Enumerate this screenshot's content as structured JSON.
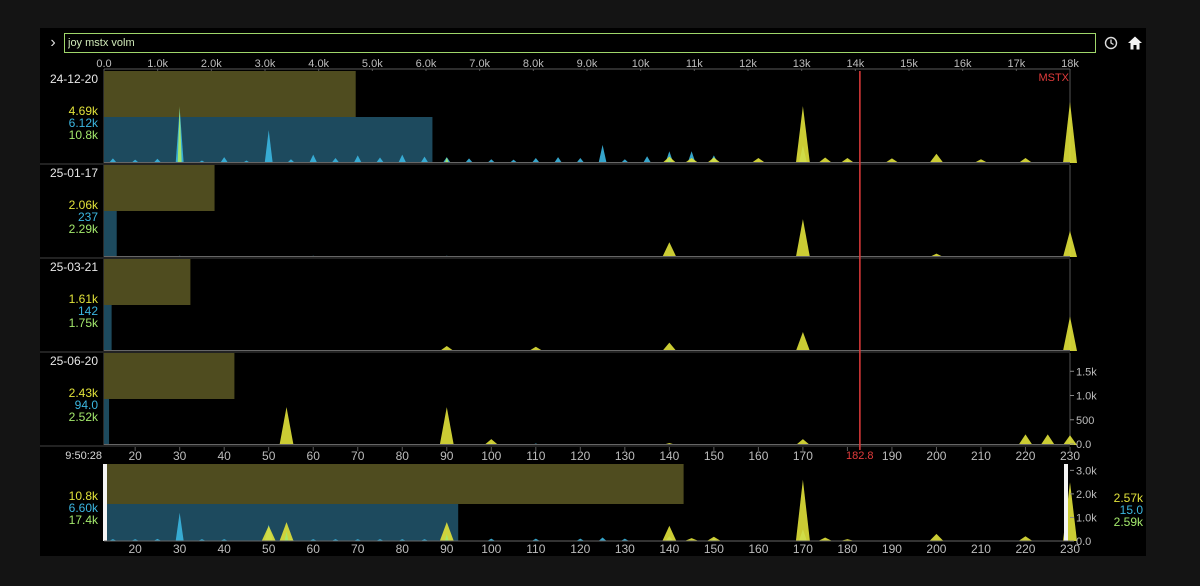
{
  "command": {
    "value": "joy mstx volm"
  },
  "icons": {
    "left": "chevron-right-icon",
    "settings": "clock-gear-icon",
    "home": "home-icon"
  },
  "colors": {
    "yellow": "#e1e23a",
    "blue": "#3bb6e0",
    "green": "#a3e86c",
    "yellow_bar": "#4f4c1f",
    "blue_bar": "#1d4a5e",
    "marker": "#e23b3b",
    "axis_text": "#bdbdbd",
    "bg": "#000000"
  },
  "chart_data": {
    "type": "area",
    "symbol": "MSTX",
    "marker": {
      "price": 182.8,
      "label": "182.8"
    },
    "time_label": "9:50:28",
    "volume_axis": {
      "ticks": [
        0,
        1000,
        2000,
        3000,
        4000,
        5000,
        6000,
        7000,
        8000,
        9000,
        10000,
        11000,
        12000,
        13000,
        14000,
        15000,
        16000,
        17000,
        18000
      ],
      "tick_labels": [
        "0.0",
        "1.0k",
        "2.0k",
        "3.0k",
        "4.0k",
        "5.0k",
        "6.0k",
        "7.0k",
        "8.0k",
        "9.0k",
        "10k",
        "11k",
        "12k",
        "13k",
        "14k",
        "15k",
        "16k",
        "17k",
        "18k"
      ],
      "range": [
        0,
        18000
      ]
    },
    "strike_axis": {
      "ticks": [
        20,
        30,
        40,
        50,
        60,
        70,
        80,
        90,
        100,
        110,
        120,
        130,
        140,
        150,
        160,
        170,
        180,
        190,
        200,
        210,
        220,
        230
      ],
      "tick_labels": [
        "20",
        "30",
        "40",
        "50",
        "60",
        "70",
        "80",
        "90",
        "100",
        "110",
        "120",
        "130",
        "140",
        "150",
        "160",
        "170",
        "",
        "190",
        "200",
        "210",
        "220",
        "230"
      ],
      "range": [
        13,
        230
      ]
    },
    "panel_scale": {
      "ticks": [
        0,
        500,
        1000,
        1500
      ],
      "labels": [
        "0.0",
        "500",
        "1.0k",
        "1.5k"
      ]
    },
    "summary_scale": {
      "ticks": [
        0,
        1000,
        2000,
        3000
      ],
      "labels": [
        "0.0",
        "1.0k",
        "2.0k",
        "3.0k"
      ]
    },
    "panels": [
      {
        "expiry": "24-12-20",
        "call_total": "4.69k",
        "put_total": "6.12k",
        "all_total": "10.8k",
        "call_bar": 4690,
        "put_bar": 6120,
        "ymax": 1900,
        "call_spikes": [
          [
            140,
            150
          ],
          [
            145,
            120
          ],
          [
            150,
            130
          ],
          [
            160,
            120
          ],
          [
            170,
            1350
          ],
          [
            175,
            130
          ],
          [
            180,
            120
          ],
          [
            190,
            110
          ],
          [
            200,
            220
          ],
          [
            210,
            90
          ],
          [
            220,
            120
          ],
          [
            230,
            1450
          ]
        ],
        "put_spikes": [
          [
            15,
            110
          ],
          [
            20,
            80
          ],
          [
            25,
            100
          ],
          [
            30,
            1300
          ],
          [
            35,
            60
          ],
          [
            40,
            140
          ],
          [
            45,
            60
          ],
          [
            50,
            780
          ],
          [
            55,
            90
          ],
          [
            60,
            200
          ],
          [
            65,
            120
          ],
          [
            70,
            180
          ],
          [
            75,
            130
          ],
          [
            80,
            200
          ],
          [
            85,
            150
          ],
          [
            90,
            140
          ],
          [
            95,
            110
          ],
          [
            100,
            90
          ],
          [
            105,
            80
          ],
          [
            110,
            120
          ],
          [
            115,
            140
          ],
          [
            120,
            120
          ],
          [
            125,
            430
          ],
          [
            130,
            90
          ],
          [
            135,
            160
          ],
          [
            140,
            280
          ],
          [
            145,
            280
          ],
          [
            150,
            180
          ],
          [
            170,
            420
          ],
          [
            180,
            60
          ]
        ],
        "green_spikes": [
          [
            30,
            1350
          ],
          [
            90,
            130
          ],
          [
            140,
            120
          ]
        ]
      },
      {
        "expiry": "25-01-17",
        "call_total": "2.06k",
        "put_total": "237",
        "all_total": "2.29k",
        "call_bar": 2060,
        "put_bar": 237,
        "ymax": 1900,
        "call_spikes": [
          [
            140,
            350
          ],
          [
            170,
            900
          ],
          [
            200,
            80
          ],
          [
            230,
            620
          ]
        ],
        "put_spikes": [
          [
            30,
            30
          ],
          [
            60,
            30
          ],
          [
            90,
            30
          ],
          [
            140,
            40
          ]
        ],
        "green_spikes": []
      },
      {
        "expiry": "25-03-21",
        "call_total": "1.61k",
        "put_total": "142",
        "all_total": "1.75k",
        "call_bar": 1610,
        "put_bar": 142,
        "ymax": 1900,
        "call_spikes": [
          [
            90,
            120
          ],
          [
            110,
            100
          ],
          [
            140,
            200
          ],
          [
            170,
            450
          ],
          [
            230,
            820
          ]
        ],
        "put_spikes": [
          [
            30,
            20
          ],
          [
            60,
            20
          ],
          [
            90,
            20
          ]
        ],
        "green_spikes": []
      },
      {
        "expiry": "25-06-20",
        "call_total": "2.43k",
        "put_total": "94.0",
        "all_total": "2.52k",
        "call_bar": 2430,
        "put_bar": 94,
        "ymax": 1650,
        "call_spikes": [
          [
            54,
            780
          ],
          [
            90,
            780
          ],
          [
            100,
            120
          ],
          [
            140,
            40
          ],
          [
            170,
            120
          ],
          [
            220,
            220
          ],
          [
            225,
            220
          ],
          [
            230,
            200
          ]
        ],
        "put_spikes": [
          [
            100,
            40
          ],
          [
            110,
            30
          ]
        ],
        "green_spikes": []
      }
    ],
    "summary": {
      "left_call": "10.8k",
      "left_put": "6.60k",
      "left_all": "17.4k",
      "right_call": "2.57k",
      "right_put": "15.0",
      "right_all": "2.59k",
      "call_bar": 10800,
      "put_bar": 6600,
      "ymax": 3100,
      "call_spikes": [
        [
          50,
          650
        ],
        [
          54,
          800
        ],
        [
          90,
          800
        ],
        [
          140,
          650
        ],
        [
          145,
          120
        ],
        [
          150,
          180
        ],
        [
          170,
          2600
        ],
        [
          175,
          150
        ],
        [
          180,
          80
        ],
        [
          200,
          300
        ],
        [
          220,
          200
        ],
        [
          230,
          2500
        ]
      ],
      "put_spikes": [
        [
          15,
          80
        ],
        [
          20,
          80
        ],
        [
          25,
          90
        ],
        [
          30,
          1200
        ],
        [
          35,
          80
        ],
        [
          40,
          80
        ],
        [
          50,
          700
        ],
        [
          55,
          80
        ],
        [
          60,
          80
        ],
        [
          65,
          80
        ],
        [
          70,
          80
        ],
        [
          75,
          80
        ],
        [
          80,
          80
        ],
        [
          85,
          80
        ],
        [
          90,
          80
        ],
        [
          100,
          100
        ],
        [
          110,
          100
        ],
        [
          120,
          100
        ],
        [
          125,
          150
        ],
        [
          130,
          100
        ],
        [
          140,
          200
        ],
        [
          150,
          100
        ],
        [
          170,
          500
        ]
      ],
      "green_spikes": [
        [
          54,
          400
        ],
        [
          90,
          300
        ]
      ]
    }
  }
}
